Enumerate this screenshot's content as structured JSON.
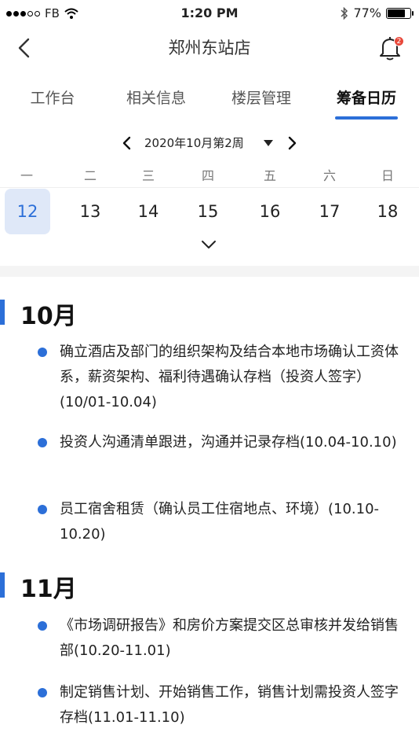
{
  "status": {
    "carrier": "FB",
    "time": "1:20 PM",
    "battery": "77%",
    "battery_level": 0.77
  },
  "nav": {
    "title": "郑州东站店",
    "badge": "2"
  },
  "tabs": [
    {
      "label": "工作台",
      "active": false
    },
    {
      "label": "相关信息",
      "active": false
    },
    {
      "label": "楼层管理",
      "active": false
    },
    {
      "label": "筹备日历",
      "active": true
    }
  ],
  "week": {
    "label": "2020年10月第2周"
  },
  "weekdays": [
    "一",
    "二",
    "三",
    "四",
    "五",
    "六",
    "日"
  ],
  "dates": [
    "12",
    "13",
    "14",
    "15",
    "16",
    "17",
    "18"
  ],
  "selected_date": "12",
  "months": [
    {
      "title": "10月",
      "items": [
        "确立酒店及部门的组织架构及结合本地市场确认工资体系，薪资架构、福利待遇确认存档（投资人签字）(10/01-10.04)",
        "投资人沟通清单跟进，沟通并记录存档(10.04-10.10)",
        "员工宿舍租赁（确认员工住宿地点、环境）(10.10-10.20)"
      ]
    },
    {
      "title": "11月",
      "items": [
        "《市场调研报告》和房价方案提交区总审核并发给销售部(10.20-11.01)",
        "制定销售计划、开始销售工作，销售计划需投资人签字存档(11.01-11.10)"
      ]
    }
  ],
  "colors": {
    "accent": "#2c6fd8",
    "badge": "#e8483a",
    "selected_bg": "#dfe8f8"
  }
}
